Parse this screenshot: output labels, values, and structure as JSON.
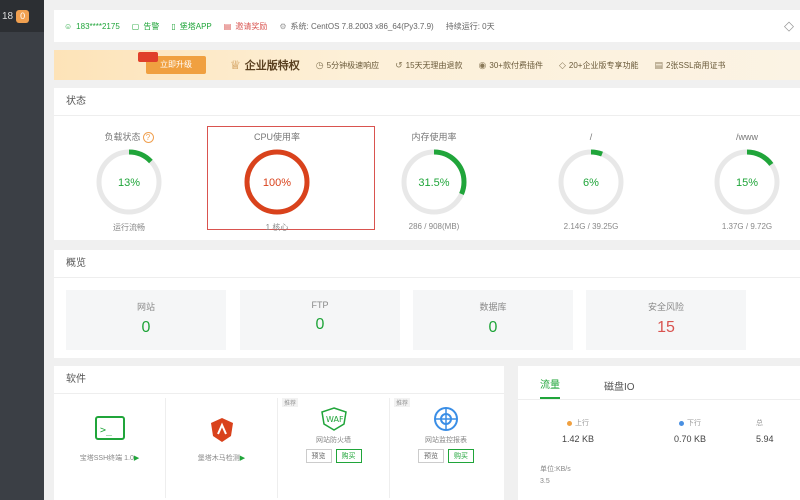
{
  "sidebar": {
    "count": "18",
    "badge": "0"
  },
  "topbar": {
    "user": "183****2175",
    "alarm": "告警",
    "app": "堡塔APP",
    "rate": "邀请奖励",
    "system_label": "系统:",
    "system_value": "CentOS 7.8.2003 x86_64(Py3.7.9)",
    "uptime": "持续运行: 0天"
  },
  "promo": {
    "upgrade": "立即升级",
    "title": "企业版特权",
    "features": [
      "5分钟极速响应",
      "15天无理由退款",
      "30+款付费插件",
      "20+企业版专享功能",
      "2张SSL商用证书"
    ]
  },
  "status": {
    "title": "状态",
    "gauges": [
      {
        "label": "负载状态",
        "percent": 13,
        "text": "13%",
        "sub": "运行流畅",
        "color": "#20a53a",
        "help": "?"
      },
      {
        "label": "CPU使用率",
        "percent": 100,
        "text": "100%",
        "sub": "1 核心",
        "color": "#d9421c"
      },
      {
        "label": "内存使用率",
        "percent": 31.5,
        "text": "31.5%",
        "sub": "286 / 908(MB)",
        "color": "#20a53a"
      },
      {
        "label": "/",
        "percent": 6,
        "text": "6%",
        "sub": "2.14G / 39.25G",
        "color": "#20a53a"
      },
      {
        "label": "/www",
        "percent": 15,
        "text": "15%",
        "sub": "1.37G / 9.72G",
        "color": "#20a53a"
      }
    ]
  },
  "overview": {
    "title": "概览",
    "cards": [
      {
        "label": "网站",
        "value": "0"
      },
      {
        "label": "FTP",
        "value": "0"
      },
      {
        "label": "数据库",
        "value": "0"
      },
      {
        "label": "安全风险",
        "value": "15"
      }
    ]
  },
  "software": {
    "title": "软件",
    "items": [
      {
        "name": "宝塔SSH终端 1.0",
        "tag": "",
        "icon": "terminal-icon"
      },
      {
        "name": "堡塔木马检测",
        "tag": "",
        "icon": "shield-icon"
      },
      {
        "name": "网站防火墙",
        "tag": "推荐",
        "icon": "waf-icon",
        "btn1": "预览",
        "btn2": "购买"
      },
      {
        "name": "网站监控报表",
        "tag": "推荐",
        "icon": "monitor-icon",
        "btn1": "预览",
        "btn2": "购买"
      }
    ]
  },
  "traffic": {
    "tabs": [
      "流量",
      "磁盘IO"
    ],
    "up_label": "上行",
    "up_value": "1.42 KB",
    "down_label": "下行",
    "down_value": "0.70 KB",
    "total_partial": "5.94",
    "total_label_partial": "总",
    "unit": "单位:KB/s",
    "axis_top": "3.5",
    "up_color": "#f0a040",
    "down_color": "#4a90e2"
  }
}
